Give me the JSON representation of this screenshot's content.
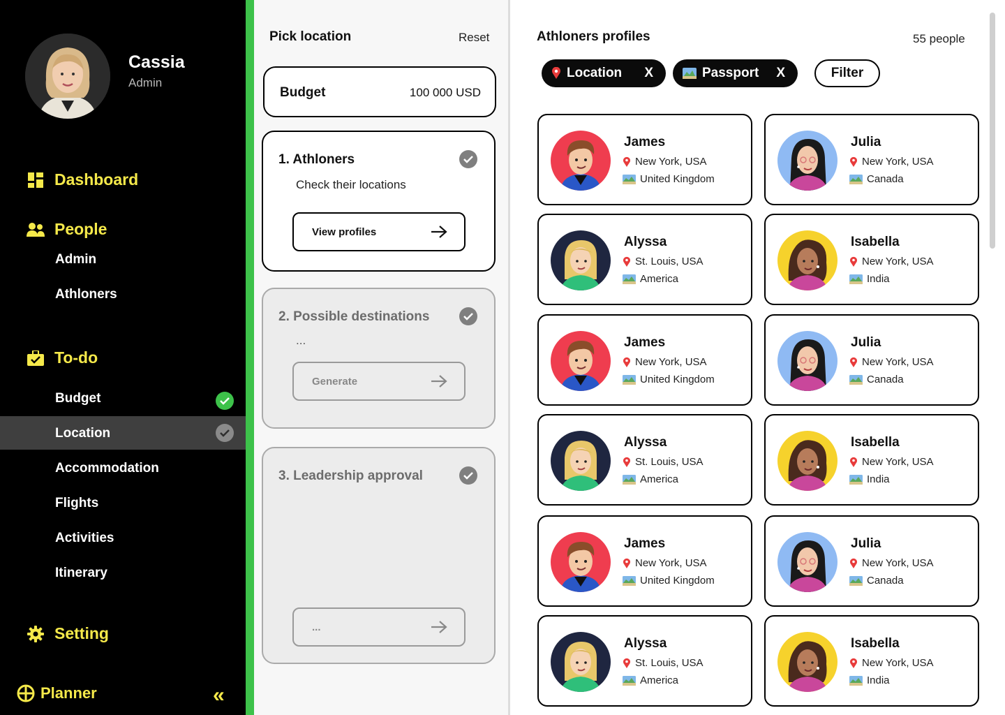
{
  "user": {
    "name": "Cassia",
    "role": "Admin"
  },
  "nav": {
    "dashboard": "Dashboard",
    "people": "People",
    "people_items": [
      "Admin",
      "Athloners"
    ],
    "todo": "To-do",
    "todo_items": [
      "Budget",
      "Location",
      "Accommodation",
      "Flights",
      "Activities",
      "Itinerary"
    ],
    "active_item": "Location",
    "setting": "Setting"
  },
  "brand": {
    "name": "Planner",
    "collapse": "«"
  },
  "pick": {
    "title": "Pick location",
    "reset": "Reset",
    "budget_label": "Budget",
    "budget_value": "100 000 USD",
    "steps": [
      {
        "title": "1. Athloners",
        "subtitle": "Check their locations",
        "button": "View profiles",
        "state": "active"
      },
      {
        "title": "2. Possible destinations",
        "subtitle": "...",
        "button": "Generate",
        "state": "disabled"
      },
      {
        "title": "3. Leadership approval",
        "subtitle": "",
        "button": "...",
        "state": "disabled"
      }
    ]
  },
  "profiles": {
    "title": "Athloners profiles",
    "count": "55 people",
    "chips": [
      {
        "label": "Location",
        "icon": "pin-icon",
        "remove": "X"
      },
      {
        "label": "Passport",
        "icon": "map-icon",
        "remove": "X"
      }
    ],
    "filter": "Filter",
    "people": [
      {
        "name": "James",
        "location": "New York, USA",
        "passport": "United Kingdom",
        "avatar_bg": "#ef3d4f"
      },
      {
        "name": "Julia",
        "location": "New York, USA",
        "passport": "Canada",
        "avatar_bg": "#8fbaf3"
      },
      {
        "name": "Alyssa",
        "location": "St. Louis, USA",
        "passport": "America",
        "avatar_bg": "#1f2640"
      },
      {
        "name": "Isabella",
        "location": "New York, USA",
        "passport": "India",
        "avatar_bg": "#f6d22c"
      },
      {
        "name": "James",
        "location": "New York, USA",
        "passport": "United Kingdom",
        "avatar_bg": "#ef3d4f"
      },
      {
        "name": "Julia",
        "location": "New York, USA",
        "passport": "Canada",
        "avatar_bg": "#8fbaf3"
      },
      {
        "name": "Alyssa",
        "location": "St. Louis, USA",
        "passport": "America",
        "avatar_bg": "#1f2640"
      },
      {
        "name": "Isabella",
        "location": "New York, USA",
        "passport": "India",
        "avatar_bg": "#f6d22c"
      },
      {
        "name": "James",
        "location": "New York, USA",
        "passport": "United Kingdom",
        "avatar_bg": "#ef3d4f"
      },
      {
        "name": "Julia",
        "location": "New York, USA",
        "passport": "Canada",
        "avatar_bg": "#8fbaf3"
      },
      {
        "name": "Alyssa",
        "location": "St. Louis, USA",
        "passport": "America",
        "avatar_bg": "#1f2640"
      },
      {
        "name": "Isabella",
        "location": "New York, USA",
        "passport": "India",
        "avatar_bg": "#f6d22c"
      }
    ]
  },
  "colors": {
    "accent": "#f5e94a",
    "success": "#3dc24a",
    "sidebar": "#000000",
    "active_row": "#3f3f3f"
  }
}
